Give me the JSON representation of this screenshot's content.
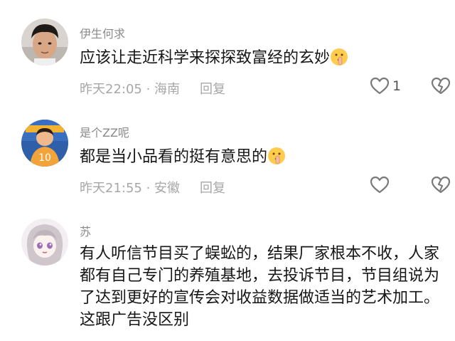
{
  "comments": [
    {
      "user": "伊生何求",
      "text": "应该让走近科学来探探致富经的玄妙",
      "time_location": "昨天22:05 · 海南",
      "reply_label": "回复",
      "like_count": "1",
      "emoji": "shushing-face-emoji"
    },
    {
      "user": "是个ZZ呢",
      "text": "都是当小品看的挺有意思的",
      "time_location": "昨天21:55 · 安徽",
      "reply_label": "回复",
      "emoji": "shushing-face-emoji"
    },
    {
      "user": "苏",
      "text": "有人听信节目买了蜈蚣的，结果厂家根本不收，人家都有自己专门的养殖基地，去投诉节目，节目组说为了达到更好的宣传会对收益数据做适当的艺术加工。这跟广告没区别"
    }
  ],
  "colors": {
    "username": "#8a8a8a",
    "meta": "#a7a7a7",
    "text": "#161616",
    "icon_stroke": "#7a7a7a"
  },
  "icons": [
    "heart-outline-icon",
    "broken-heart-icon"
  ]
}
